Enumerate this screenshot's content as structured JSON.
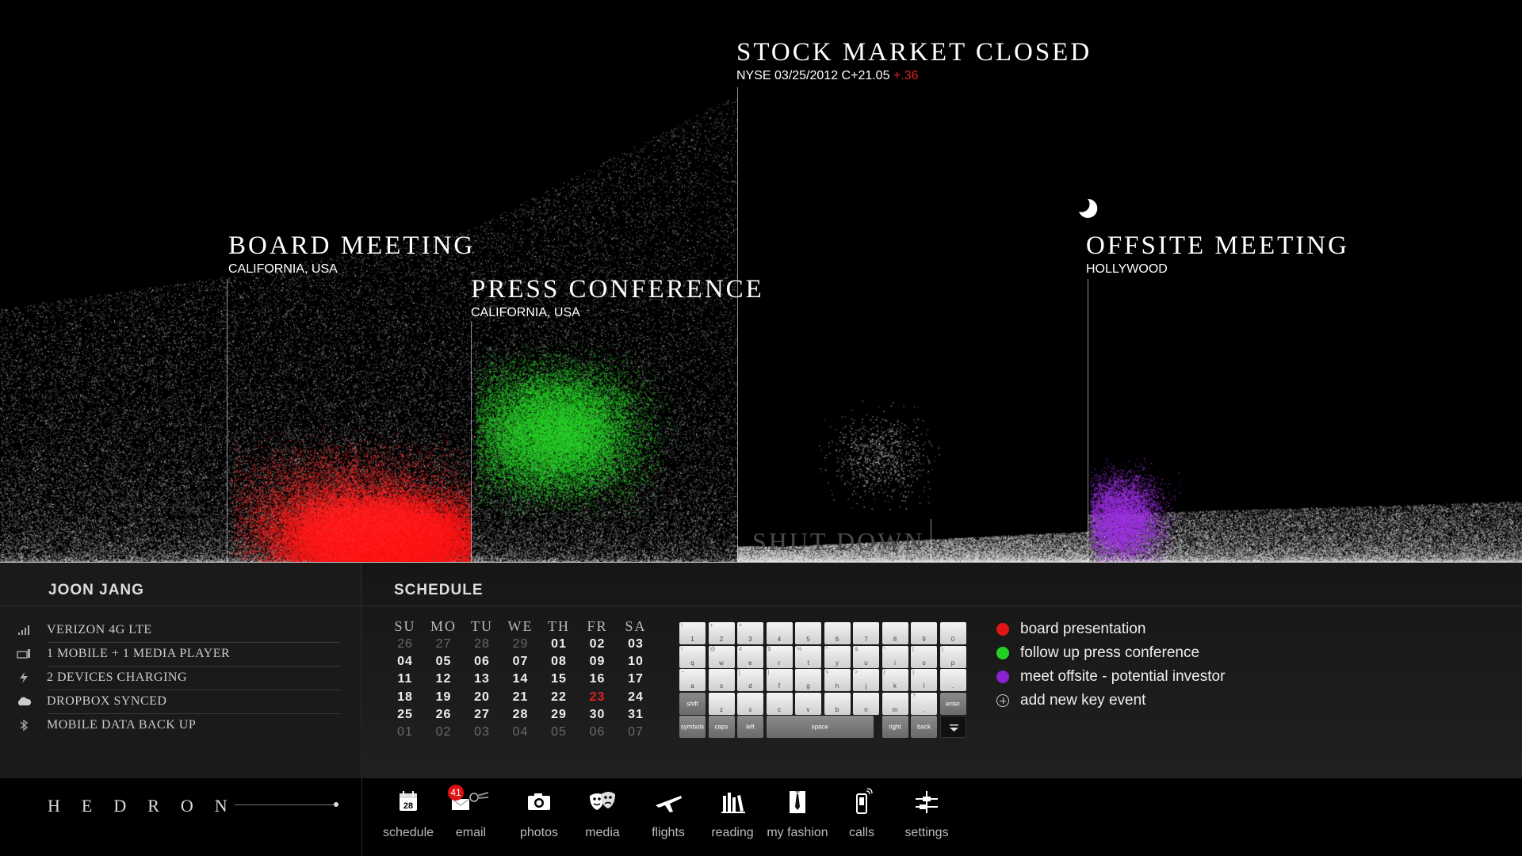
{
  "events": {
    "board": {
      "title": "BOARD MEETING",
      "subtitle": "CALIFORNIA, USA"
    },
    "press": {
      "title": "PRESS CONFERENCE",
      "subtitle": "CALIFORNIA, USA"
    },
    "stock": {
      "title": "STOCK MARKET CLOSED",
      "subtitle": "NYSE 03/25/2012 C+21.05",
      "delta": "+.36"
    },
    "offsite": {
      "title": "OFFSITE MEETING",
      "subtitle": "HOLLYWOOD"
    },
    "shutdown": "SHUT DOWN"
  },
  "profile": {
    "name": "JOON JANG",
    "status": [
      {
        "icon": "signal-icon",
        "label": "VERIZON 4G LTE"
      },
      {
        "icon": "devices-icon",
        "label": "1 MOBILE + 1 MEDIA PLAYER"
      },
      {
        "icon": "charging-icon",
        "label": "2 DEVICES CHARGING"
      },
      {
        "icon": "cloud-icon",
        "label": "DROPBOX SYNCED"
      },
      {
        "icon": "bluetooth-icon",
        "label": "MOBILE DATA BACK UP"
      }
    ]
  },
  "schedule": {
    "title": "SCHEDULE",
    "weekdays": [
      "SU",
      "MO",
      "TU",
      "WE",
      "TH",
      "FR",
      "SA"
    ],
    "weeks": [
      [
        "26",
        "27",
        "28",
        "29",
        "01",
        "02",
        "03"
      ],
      [
        "04",
        "05",
        "06",
        "07",
        "08",
        "09",
        "10"
      ],
      [
        "11",
        "12",
        "13",
        "14",
        "15",
        "16",
        "17"
      ],
      [
        "18",
        "19",
        "20",
        "21",
        "22",
        "23",
        "24"
      ],
      [
        "25",
        "26",
        "27",
        "28",
        "29",
        "30",
        "31"
      ],
      [
        "01",
        "02",
        "03",
        "04",
        "05",
        "06",
        "07"
      ]
    ],
    "today": "23",
    "key_events": [
      {
        "label": "board presentation",
        "color": "#e01515"
      },
      {
        "label": "follow up press conference",
        "color": "#22d022"
      },
      {
        "label": "meet offsite - potential investor",
        "color": "#8a22d0"
      }
    ],
    "add_event": "add new key event"
  },
  "keyboard": {
    "rows": [
      [
        [
          "\\",
          "1"
        ],
        [
          "+",
          "2"
        ],
        [
          "=",
          "3"
        ],
        [
          "",
          "4"
        ],
        [
          "",
          "5"
        ],
        [
          "",
          "6"
        ],
        [
          "",
          "7"
        ],
        [
          "",
          "8"
        ],
        [
          "",
          "9"
        ],
        [
          "",
          "0"
        ]
      ],
      [
        [
          "!",
          "q"
        ],
        [
          "@",
          "w"
        ],
        [
          "#",
          "e"
        ],
        [
          "$",
          "r"
        ],
        [
          "%",
          "t"
        ],
        [
          "^",
          "y"
        ],
        [
          "&",
          "u"
        ],
        [
          "*",
          "i"
        ],
        [
          "(",
          "o"
        ],
        [
          ")",
          "p"
        ]
      ],
      [
        [
          "~",
          "a"
        ],
        [
          "",
          "s"
        ],
        [
          "[",
          "d"
        ],
        [
          "]",
          "f"
        ],
        [
          "",
          "g"
        ],
        [
          "<",
          "h"
        ],
        [
          ">",
          "j"
        ],
        [
          "{",
          "k"
        ],
        [
          "}",
          "l"
        ],
        [
          "",
          "."
        ]
      ],
      [
        [
          "",
          "z"
        ],
        [
          "",
          "x"
        ],
        [
          "",
          "c"
        ],
        [
          "",
          "v"
        ],
        [
          "",
          "b"
        ],
        [
          "",
          "n"
        ],
        [
          "",
          "m"
        ],
        [
          "?",
          ","
        ]
      ]
    ],
    "shift": "shift",
    "enter": "enter",
    "symbols": "symbols",
    "caps": "caps",
    "left": "left",
    "space": "space",
    "right": "right",
    "back": "back"
  },
  "brand": "HEDRON",
  "dock": [
    {
      "label": "schedule",
      "icon": "calendar-icon",
      "icon_text": "28"
    },
    {
      "label": "email",
      "icon": "email-icon",
      "badge": "41"
    },
    {
      "label": "photos",
      "icon": "camera-icon"
    },
    {
      "label": "media",
      "icon": "theater-masks-icon"
    },
    {
      "label": "flights",
      "icon": "airplane-icon"
    },
    {
      "label": "reading",
      "icon": "books-icon"
    },
    {
      "label": "my fashion",
      "icon": "shirt-tie-icon"
    },
    {
      "label": "calls",
      "icon": "phone-icon"
    },
    {
      "label": "settings",
      "icon": "settings-sliders-icon"
    }
  ],
  "colors": {
    "board": "#ff1a1a",
    "press": "#2ed02e",
    "offsite": "#9a30e0",
    "alert": "#e02020"
  }
}
